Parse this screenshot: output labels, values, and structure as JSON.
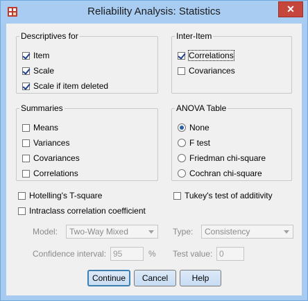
{
  "window": {
    "title": "Reliability Analysis: Statistics",
    "close_glyph": "✕"
  },
  "descriptives": {
    "legend": "Descriptives for",
    "items": [
      {
        "label": "Item",
        "checked": true
      },
      {
        "label": "Scale",
        "checked": true
      },
      {
        "label": "Scale if item deleted",
        "checked": true
      }
    ]
  },
  "inter_item": {
    "legend": "Inter-Item",
    "items": [
      {
        "label": "Correlations",
        "checked": true
      },
      {
        "label": "Covariances",
        "checked": false
      }
    ]
  },
  "summaries": {
    "legend": "Summaries",
    "items": [
      {
        "label": "Means",
        "checked": false
      },
      {
        "label": "Variances",
        "checked": false
      },
      {
        "label": "Covariances",
        "checked": false
      },
      {
        "label": "Correlations",
        "checked": false
      }
    ]
  },
  "anova": {
    "legend": "ANOVA Table",
    "options": [
      {
        "label": "None",
        "selected": true
      },
      {
        "label": "F test",
        "selected": false
      },
      {
        "label": "Friedman chi-square",
        "selected": false
      },
      {
        "label": "Cochran chi-square",
        "selected": false
      }
    ]
  },
  "extras": {
    "hotelling": "Hotelling's T-square",
    "tukey": "Tukey's test of additivity",
    "intraclass": "Intraclass correlation coefficient"
  },
  "icc": {
    "model_label": "Model:",
    "model_value": "Two-Way Mixed",
    "type_label": "Type:",
    "type_value": "Consistency",
    "ci_label": "Confidence interval:",
    "ci_value": "95",
    "percent": "%",
    "test_label": "Test value:",
    "test_value": "0"
  },
  "buttons": {
    "continue": "Continue",
    "cancel": "Cancel",
    "help": "Help"
  },
  "colors": {
    "titlebar": "#a9cdf2",
    "close": "#c7463c",
    "check": "#1e3e8c"
  }
}
